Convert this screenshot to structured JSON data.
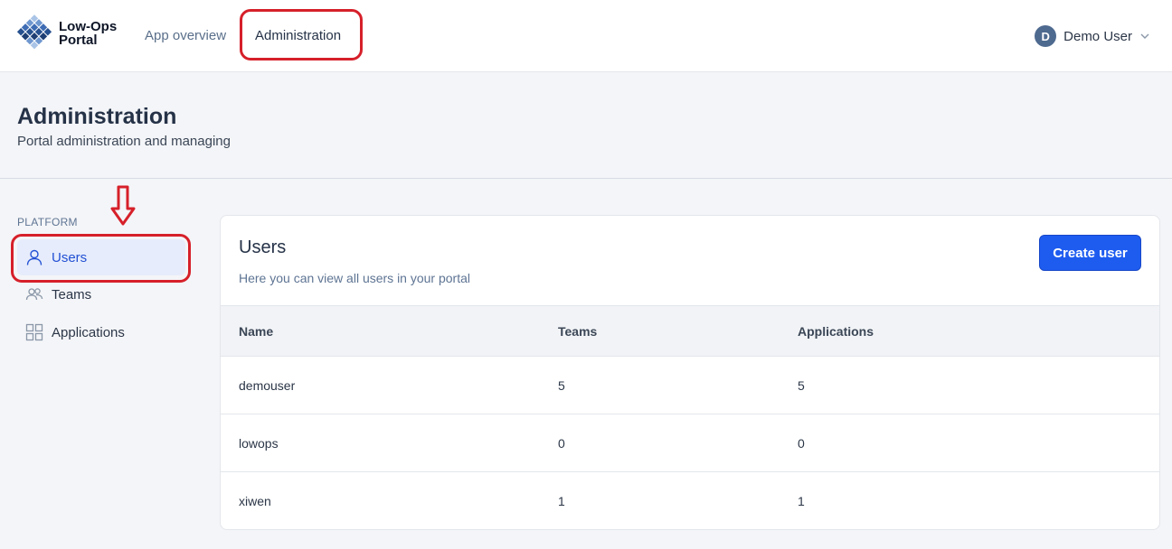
{
  "header": {
    "brand_line1": "Low-Ops",
    "brand_line2": "Portal",
    "nav": [
      {
        "label": "App overview"
      },
      {
        "label": "Administration"
      }
    ],
    "user": {
      "initial": "D",
      "name": "Demo User"
    }
  },
  "page": {
    "title": "Administration",
    "subtitle": "Portal administration and managing"
  },
  "sidebar": {
    "section_label": "PLATFORM",
    "items": [
      {
        "label": "Users",
        "icon": "user-icon"
      },
      {
        "label": "Teams",
        "icon": "teams-icon"
      },
      {
        "label": "Applications",
        "icon": "grid-icon"
      }
    ]
  },
  "users_card": {
    "title": "Users",
    "subtitle": "Here you can view all users in your portal",
    "create_button": "Create user",
    "columns": [
      "Name",
      "Teams",
      "Applications"
    ],
    "rows": [
      {
        "name": "demouser",
        "teams": "5",
        "applications": "5"
      },
      {
        "name": "lowops",
        "teams": "0",
        "applications": "0"
      },
      {
        "name": "xiwen",
        "teams": "1",
        "applications": "1"
      }
    ]
  },
  "colors": {
    "accent": "#1e5cf0",
    "annotation": "#d6202a",
    "active_bg": "#e6ecfb"
  }
}
